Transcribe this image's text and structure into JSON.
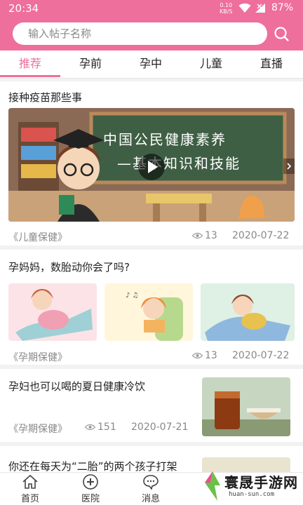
{
  "status_bar": {
    "time": "20:34",
    "net_speed": "0.10",
    "net_unit": "KB/S",
    "battery": "87%"
  },
  "search": {
    "placeholder": "输入帖子名称"
  },
  "tabs": [
    {
      "label": "推荐",
      "active": true
    },
    {
      "label": "孕前",
      "active": false
    },
    {
      "label": "孕中",
      "active": false
    },
    {
      "label": "儿童",
      "active": false
    },
    {
      "label": "直播",
      "active": false
    }
  ],
  "feed": {
    "cards": [
      {
        "title": "接种疫苗那些事",
        "cover_text_line1": "中国公民健康素养",
        "cover_text_line2": "—基本知识和技能",
        "category": "《儿童保健》",
        "views": "13",
        "date": "2020-07-22"
      },
      {
        "title": "孕妈妈，数胎动你会了吗?",
        "category": "《孕期保健》",
        "views": "13",
        "date": "2020-07-22"
      },
      {
        "title": "孕妇也可以喝的夏日健康冷饮",
        "category": "《孕期保健》",
        "views": "151",
        "date": "2020-07-21"
      },
      {
        "title": "你还在每天为“二胎”的两个孩子打架"
      }
    ]
  },
  "bottom_nav": [
    {
      "label": "首页",
      "icon": "home-icon"
    },
    {
      "label": "医院",
      "icon": "hospital-icon"
    },
    {
      "label": "消息",
      "icon": "message-icon"
    }
  ],
  "watermark": {
    "text": "寰晟手游网",
    "url": "huan-sun.com"
  },
  "colors": {
    "accent": "#ee6e9c"
  }
}
